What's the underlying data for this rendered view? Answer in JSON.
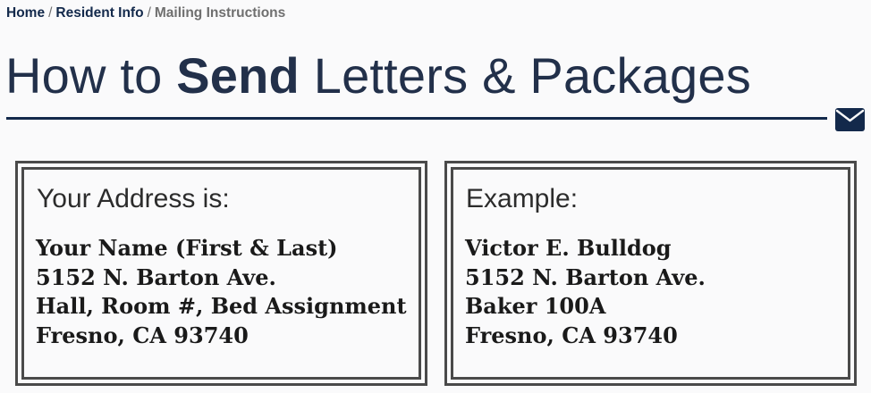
{
  "breadcrumb": {
    "home": "Home",
    "separator": "/",
    "resident_info": "Resident Info",
    "current": "Mailing Instructions"
  },
  "title": {
    "before": "How to ",
    "bold": "Send",
    "after": " Letters & Packages"
  },
  "icons": {
    "mail": "envelope-icon"
  },
  "colors": {
    "navy": "#13294b",
    "border": "#4a4a4a",
    "muted": "#6f6f6f"
  },
  "address_card": {
    "heading": "Your Address is:",
    "lines": [
      "Your Name (First & Last)",
      "5152 N. Barton Ave.",
      "Hall, Room #, Bed Assignment",
      "Fresno, CA 93740"
    ]
  },
  "example_card": {
    "heading": "Example:",
    "lines": [
      "Victor E. Bulldog",
      "5152 N. Barton Ave.",
      "Baker 100A",
      "Fresno, CA 93740"
    ]
  }
}
